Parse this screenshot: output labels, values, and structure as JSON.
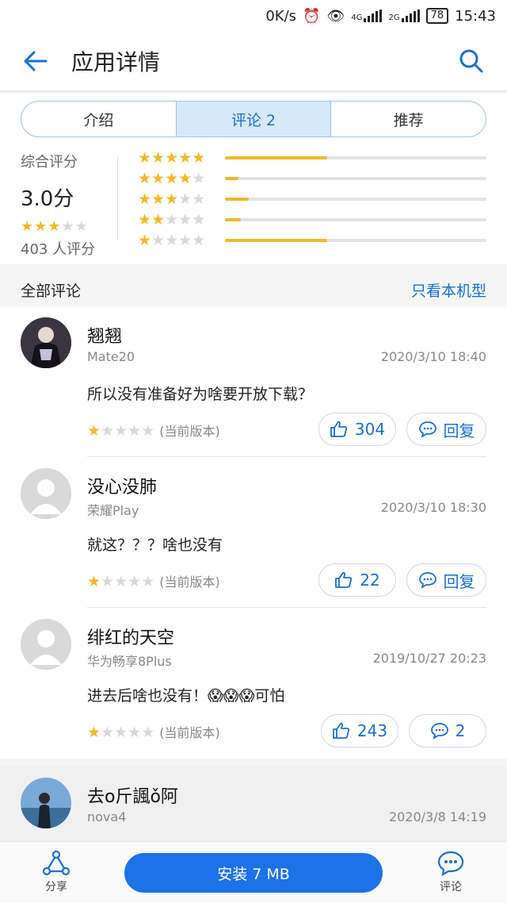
{
  "status_bar": {
    "speed": "0K/s",
    "network": "4G",
    "network2": "2G",
    "battery": "78",
    "time": "15:43"
  },
  "app_bar": {
    "title": "应用详情"
  },
  "tabs": [
    {
      "label": "介绍"
    },
    {
      "label": "评论 2"
    },
    {
      "label": "推荐"
    }
  ],
  "rating": {
    "label": "综合评分",
    "score": "3.0分",
    "stars": 3,
    "count": "403 人评分",
    "distribution": [
      {
        "stars": 5,
        "fraction": 0.39
      },
      {
        "stars": 4,
        "fraction": 0.05
      },
      {
        "stars": 3,
        "fraction": 0.09
      },
      {
        "stars": 2,
        "fraction": 0.06
      },
      {
        "stars": 1,
        "fraction": 0.39
      }
    ]
  },
  "section": {
    "title": "全部评论",
    "filter_link": "只看本机型"
  },
  "reviews": [
    {
      "name": "翘翘",
      "device": "Mate20",
      "time": "2020/3/10 18:40",
      "text": "所以没有准备好为啥要开放下载？",
      "stars": 1,
      "version": "(当前版本)",
      "likes": "304",
      "reply": "回复"
    },
    {
      "name": "没心没肺",
      "device": "荣耀Play",
      "time": "2020/3/10 18:30",
      "text": "就这？？？啥也没有",
      "stars": 1,
      "version": "(当前版本)",
      "likes": "22",
      "reply": "回复"
    },
    {
      "name": "绯红的天空",
      "device": "华为畅享8Plus",
      "time": "2019/10/27 20:23",
      "text": "进去后啥也没有！😱😱😱可怕",
      "stars": 1,
      "version": "(当前版本)",
      "likes": "243",
      "reply": "2"
    },
    {
      "name": "去o斤諷ǒ阿",
      "device": "nova4",
      "time": "2020/3/8 14:19"
    }
  ],
  "bottom_bar": {
    "share_label": "分享",
    "install_label": "安装 7 MB",
    "comment_label": "评论"
  },
  "colors": {
    "accent": "#1a6fd0",
    "star": "#f2b72a",
    "install": "#1d72e8"
  }
}
